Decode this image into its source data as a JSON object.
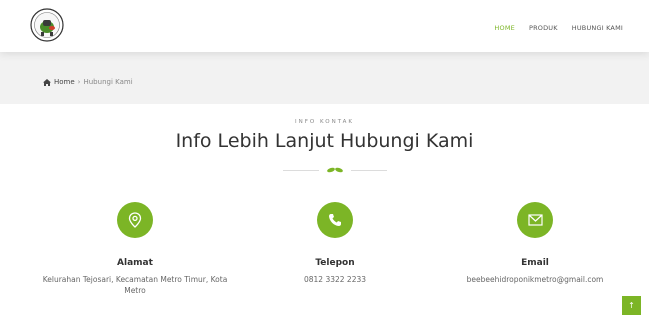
{
  "nav": {
    "items": [
      {
        "label": "HOME",
        "active": true
      },
      {
        "label": "PRODUK",
        "active": false
      },
      {
        "label": "HUBUNGI KAMI",
        "active": false
      }
    ]
  },
  "breadcrumb": {
    "home": "Home",
    "separator": "›",
    "current": "Hubungi Kami"
  },
  "section": {
    "tag": "INFO KONTAK",
    "title": "Info Lebih Lanjut Hubungi Kami"
  },
  "contacts": [
    {
      "icon": "location-pin-icon",
      "title": "Alamat",
      "text": "Kelurahan Tejosari, Kecamatan Metro Timur, Kota Metro"
    },
    {
      "icon": "phone-icon",
      "title": "Telepon",
      "text": "0812 3322 2233"
    },
    {
      "icon": "envelope-icon",
      "title": "Email",
      "text": "beebeehidroponikmetro@gmail.com"
    }
  ],
  "scroll_top": {
    "label": "↑"
  },
  "colors": {
    "accent": "#7cb526",
    "breadcrumb_bg": "#f2f2f2"
  }
}
